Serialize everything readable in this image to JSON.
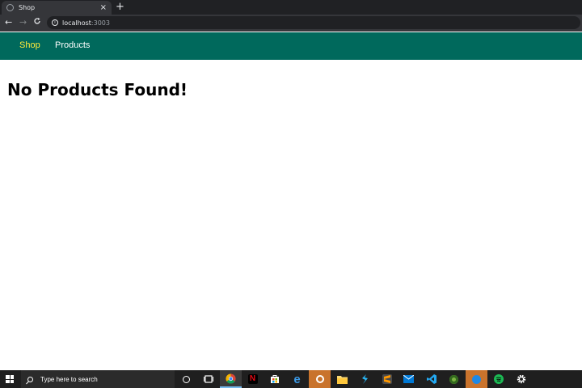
{
  "browser": {
    "tab_title": "Shop",
    "tab_close": "×",
    "new_tab": "+",
    "back": "←",
    "forward": "→",
    "reload": "C",
    "url_host": "localhost",
    "url_port": ":3003"
  },
  "nav": {
    "items": [
      {
        "label": "Shop",
        "active": true
      },
      {
        "label": "Products",
        "active": false
      }
    ]
  },
  "main": {
    "heading": "No Products Found!"
  },
  "taskbar": {
    "search_placeholder": "Type here to search",
    "apps": [
      "cortana-icon",
      "task-view-icon",
      "chrome-icon",
      "netflix-icon",
      "store-icon",
      "edge-icon",
      "app-orange-icon",
      "file-explorer-icon",
      "visual-studio-code-insiders-icon",
      "sublime-text-icon",
      "mail-icon",
      "vscode-icon",
      "app-green-icon",
      "app-blue-icon",
      "spotify-icon",
      "settings-icon"
    ]
  },
  "colors": {
    "nav_bg": "#00695c",
    "nav_active": "#ffeb3b",
    "chrome_dark": "#202124",
    "taskbar_bg": "#1f1f1f"
  }
}
